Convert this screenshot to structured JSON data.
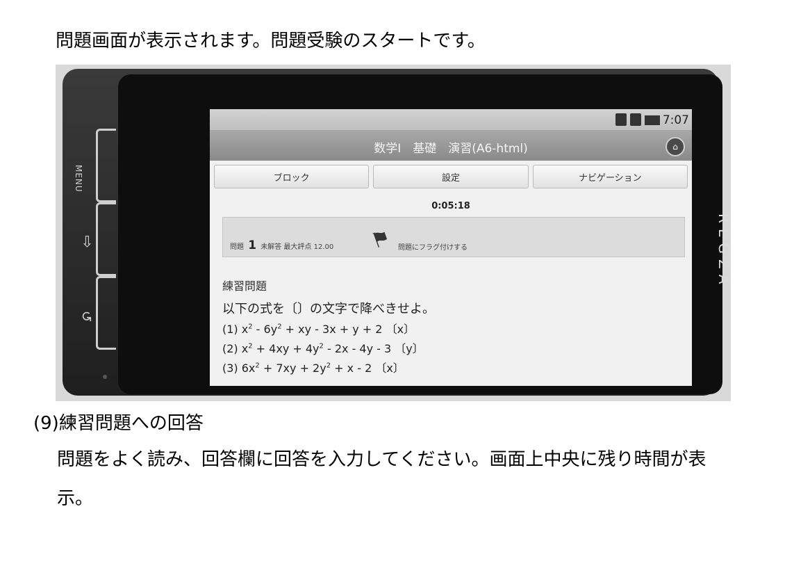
{
  "doc": {
    "intro": "問題画面が表示されます。問題受験のスタートです。",
    "section_heading": "(9)練習問題への回答",
    "body_line1": "問題をよく読み、回答欄に回答を入力してください。画面上中央に残り時間が表",
    "body_line2": "示。"
  },
  "phone": {
    "brand": "REGZA",
    "menu_label": "MENU",
    "status": {
      "time": "7:07"
    },
    "app": {
      "title": "数学Ⅰ　基礎　演習(A6-html)",
      "tabs": [
        "ブロック",
        "設定",
        "ナビゲーション"
      ],
      "timer": "0:05:18",
      "question": {
        "prefix": "問題",
        "number": "1",
        "meta": "未解答 最大評点 12.00",
        "flag_text": "問題にフラグ付けする"
      },
      "practice_title": "練習問題",
      "instruction": "以下の式を〔〕の文字で降べきせよ。",
      "equations": [
        {
          "label": "(1) x",
          "parts": [
            "2",
            " - 6y",
            "2",
            " + xy - 3x + y + 2 〔x〕"
          ]
        },
        {
          "label": "(2) x",
          "parts": [
            "2",
            " + 4xy + 4y",
            "2",
            " - 2x - 4y - 3 〔y〕"
          ]
        },
        {
          "label": "(3) 6x",
          "parts": [
            "2",
            " + 7xy + 2y",
            "2",
            " + x - 2 〔x〕"
          ]
        }
      ]
    }
  }
}
